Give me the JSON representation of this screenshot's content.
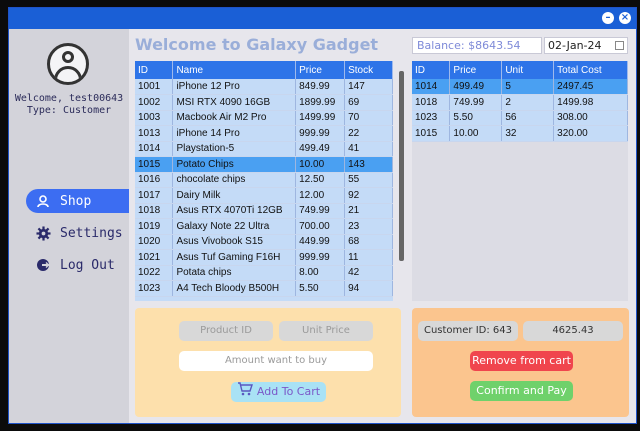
{
  "user": {
    "welcome": "Welcome, test00643",
    "type": "Type: Customer"
  },
  "nav": [
    {
      "label": "Shop",
      "icon": "user-icon",
      "active": true
    },
    {
      "label": "Settings",
      "icon": "gear-icon",
      "active": false
    },
    {
      "label": "Log Out",
      "icon": "logout-icon",
      "active": false
    }
  ],
  "header": {
    "title": "Welcome to Galaxy Gadget",
    "balance": "Balance: $8643.54",
    "date": "02-Jan-24"
  },
  "products": {
    "columns": [
      "ID",
      "Name",
      "Price",
      "Stock"
    ],
    "rows": [
      [
        "1001",
        "iPhone 12 Pro",
        "849.99",
        "147"
      ],
      [
        "1002",
        "MSI RTX 4090 16GB",
        "1899.99",
        "69"
      ],
      [
        "1003",
        "Macbook Air M2 Pro",
        "1499.99",
        "70"
      ],
      [
        "1013",
        "iPhone 14 Pro",
        "999.99",
        "22"
      ],
      [
        "1014",
        "Playstation-5",
        "499.49",
        "41"
      ],
      [
        "1015",
        "Potato Chips",
        "10.00",
        "143"
      ],
      [
        "1016",
        "chocolate chips",
        "12.50",
        "55"
      ],
      [
        "1017",
        "Dairy Milk",
        "12.00",
        "92"
      ],
      [
        "1018",
        "Asus RTX 4070Ti 12GB",
        "749.99",
        "21"
      ],
      [
        "1019",
        "Galaxy Note 22 Ultra",
        "700.00",
        "23"
      ],
      [
        "1020",
        "Asus Vivobook S15",
        "449.99",
        "68"
      ],
      [
        "1021",
        "Asus Tuf Gaming F16H",
        "999.99",
        "11"
      ],
      [
        "1022",
        "Potata chips",
        "8.00",
        "42"
      ],
      [
        "1023",
        "A4 Tech Bloody B500H",
        "5.50",
        "94"
      ]
    ],
    "selected_index": 5
  },
  "cart": {
    "columns": [
      "ID",
      "Price",
      "Unit",
      "Total Cost"
    ],
    "rows": [
      [
        "1014",
        "499.49",
        "5",
        "2497.45"
      ],
      [
        "1018",
        "749.99",
        "2",
        "1499.98"
      ],
      [
        "1023",
        "5.50",
        "56",
        "308.00"
      ],
      [
        "1015",
        "10.00",
        "32",
        "320.00"
      ]
    ],
    "selected_index": 0
  },
  "order_form": {
    "product_id_placeholder": "Product ID",
    "unit_price_placeholder": "Unit Price",
    "amount_placeholder": "Amount want to buy",
    "add_to_cart": "Add To Cart"
  },
  "checkout": {
    "customer_id": "Customer ID: 643",
    "total": "4625.43",
    "remove": "Remove from cart",
    "confirm": "Confirm and Pay"
  },
  "colors": {
    "accent": "#2e74e8",
    "remove": "#f0454d",
    "confirm": "#6fd16b",
    "add_to_cart": "#a9e2f5"
  }
}
